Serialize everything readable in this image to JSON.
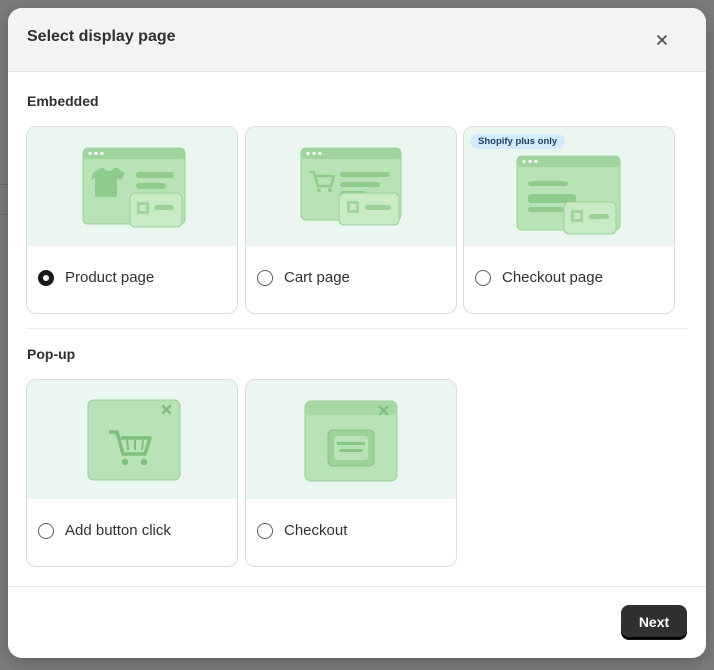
{
  "dialog": {
    "title": "Select display page",
    "close_icon": "close-icon"
  },
  "embedded": {
    "heading": "Embedded",
    "options": [
      {
        "label": "Product page",
        "selected": true,
        "icon": "tshirt-icon"
      },
      {
        "label": "Cart page",
        "selected": false,
        "icon": "cart-icon"
      },
      {
        "label": "Checkout page",
        "selected": false,
        "icon": "checkout-window-icon",
        "badge": "Shopify plus only"
      }
    ]
  },
  "popup": {
    "heading": "Pop-up",
    "options": [
      {
        "label": "Add button click",
        "selected": false,
        "icon": "cart-popup-icon"
      },
      {
        "label": "Checkout",
        "selected": false,
        "icon": "card-popup-icon"
      }
    ]
  },
  "footer": {
    "next_label": "Next"
  },
  "colors": {
    "accent_dark": "#303030",
    "illustration_bg": "#eaf6ef",
    "illustration_green": "#a9dba8",
    "badge_bg": "#d4ebff"
  }
}
